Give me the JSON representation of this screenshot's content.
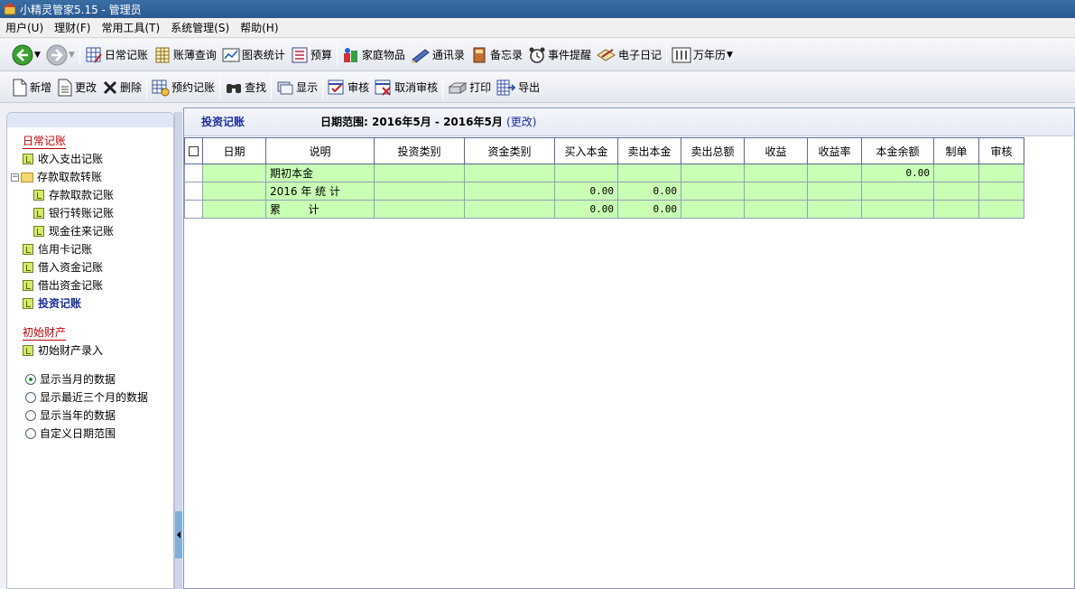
{
  "window": {
    "title": "小精灵管家5.15  - 管理员"
  },
  "menu": [
    "用户(U)",
    "理财(F)",
    "常用工具(T)",
    "系统管理(S)",
    "帮助(H)"
  ],
  "toolbar1": [
    "日常记账",
    "账薄查询",
    "图表统计",
    "预算",
    "家庭物品",
    "通讯录",
    "备忘录",
    "事件提醒",
    "电子日记",
    "万年历"
  ],
  "toolbar2": [
    "新增",
    "更改",
    "删除",
    "预约记账",
    "查找",
    "显示",
    "审核",
    "取消审核",
    "打印",
    "导出"
  ],
  "sidebar": {
    "group1": "日常记账",
    "items1": [
      "收入支出记账",
      "存款取款转账",
      "存款取款记账",
      "银行转账记账",
      "现金往来记账",
      "信用卡记账",
      "借入资金记账",
      "借出资金记账",
      "投资记账"
    ],
    "group2": "初始财产",
    "items2": [
      "初始财产录入"
    ],
    "radios": [
      "显示当月的数据",
      "显示最近三个月的数据",
      "显示当年的数据",
      "自定义日期范围"
    ]
  },
  "main": {
    "title": "投资记账",
    "range_label": "日期范围:",
    "range_value": "2016年5月 - 2016年5月",
    "range_link": "(更改)"
  },
  "table": {
    "columns": [
      "日期",
      "说明",
      "投资类别",
      "资金类别",
      "买入本金",
      "卖出本金",
      "卖出总额",
      "收益",
      "收益率",
      "本金余额",
      "制单",
      "审核"
    ],
    "rows": [
      [
        "",
        "期初本金",
        "",
        "",
        "",
        "",
        "",
        "",
        "",
        "0.00",
        "",
        ""
      ],
      [
        "",
        "2016 年 统 计",
        "",
        "",
        "0.00",
        "0.00",
        "",
        "",
        "",
        "",
        "",
        ""
      ],
      [
        "",
        "累        计",
        "",
        "",
        "0.00",
        "0.00",
        "",
        "",
        "",
        "",
        "",
        ""
      ]
    ]
  },
  "colors": {
    "title_bar": "#2a5a92",
    "grid_row": "#c9ffb4",
    "accent": "#1a2c9c",
    "group_title": "#c00000"
  }
}
